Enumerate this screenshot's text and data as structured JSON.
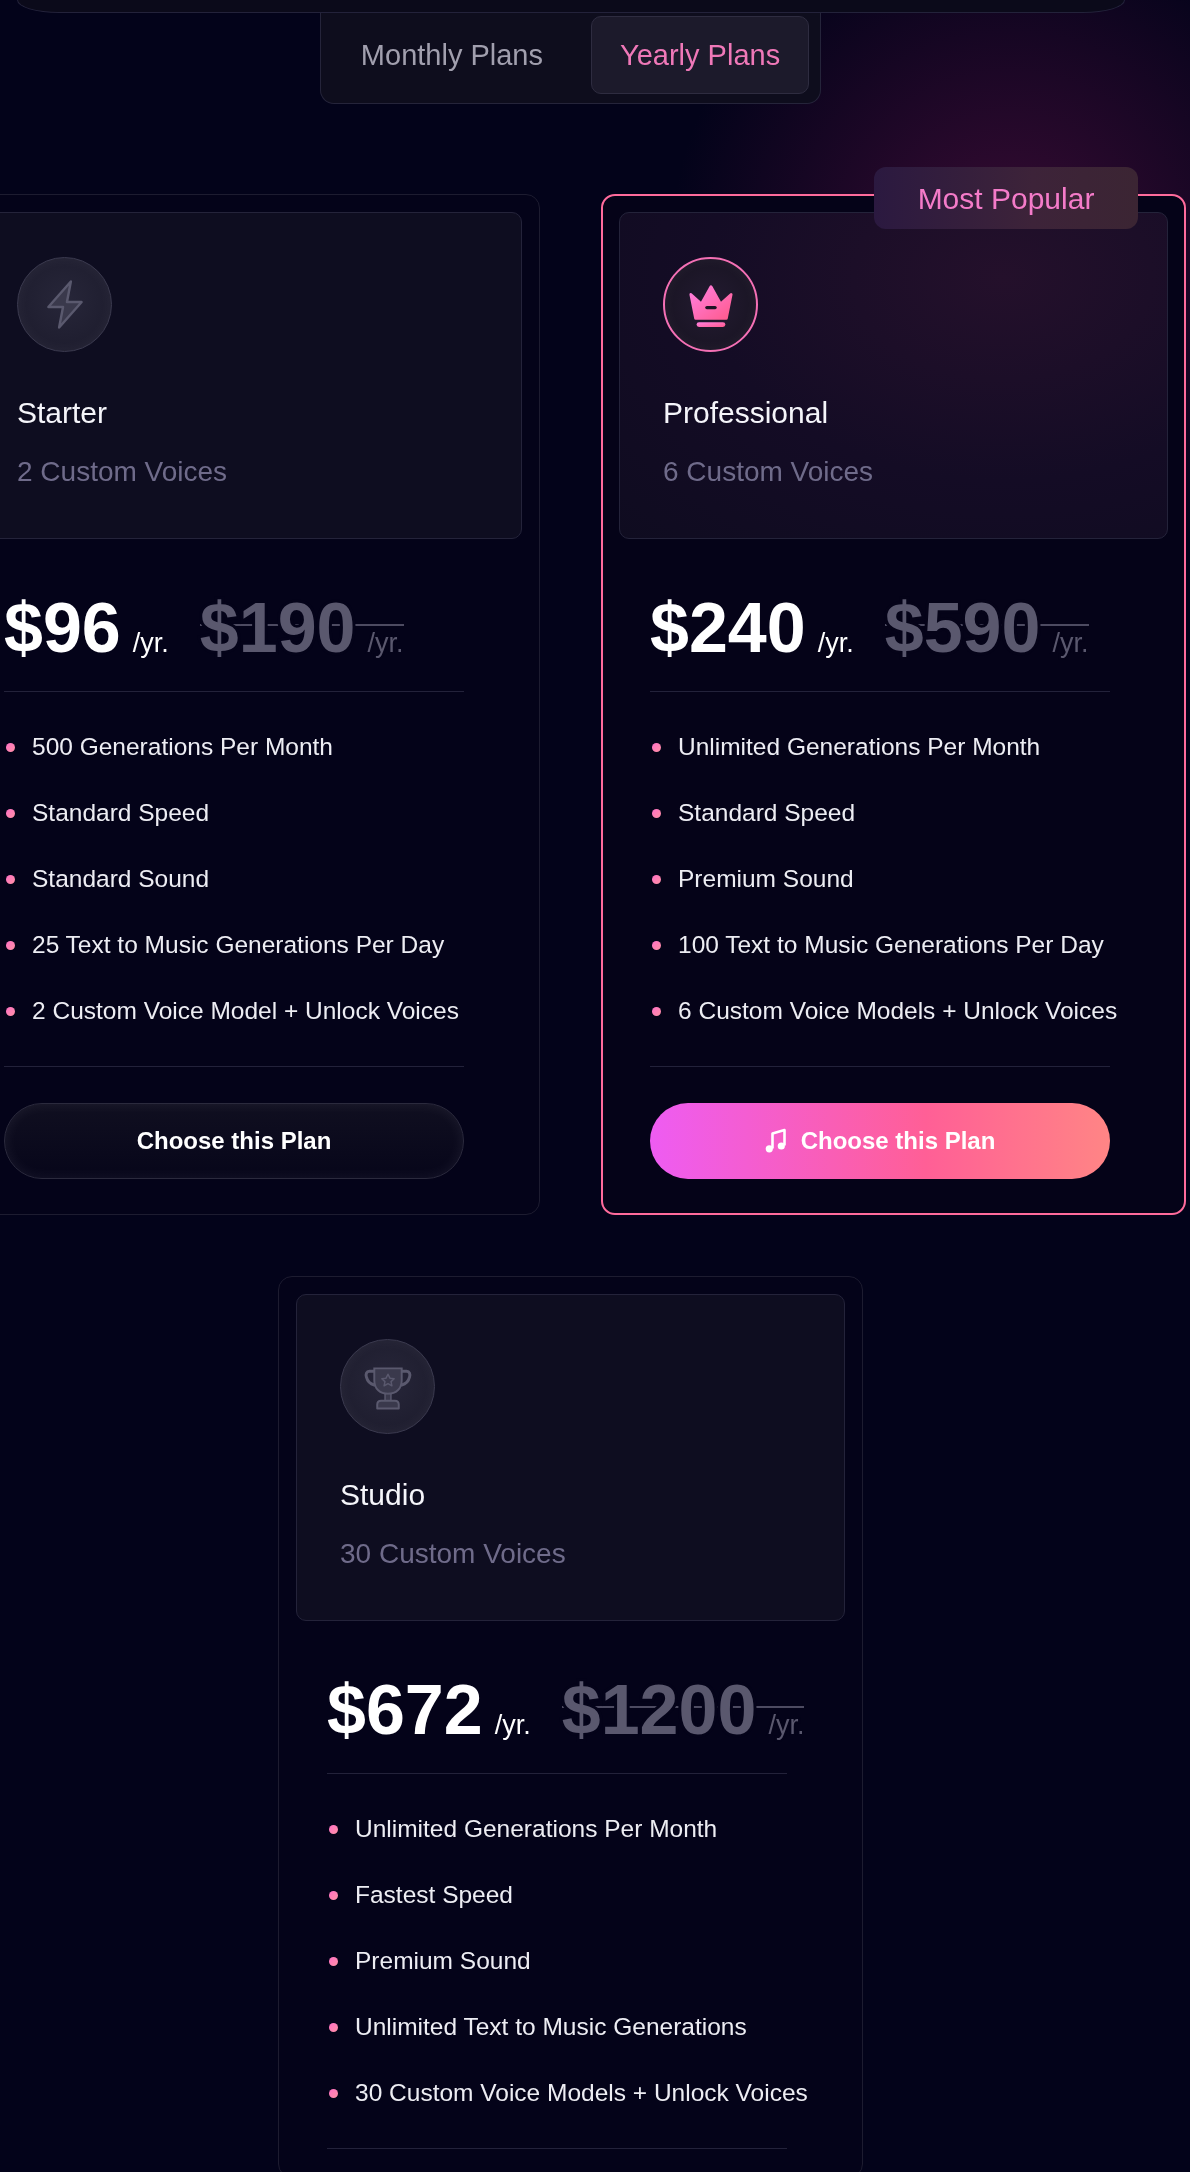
{
  "billing_tabs": [
    {
      "label": "Monthly Plans",
      "selected": false
    },
    {
      "label": "Yearly Plans",
      "selected": true
    }
  ],
  "plans": [
    {
      "name": "Starter",
      "voices": "2 Custom Voices",
      "featured": false,
      "price": "$96",
      "period": "/yr.",
      "old_price": "$190",
      "old_period": "/yr.",
      "features": [
        "500 Generations Per Month",
        "Standard Speed",
        "Standard Sound",
        "25 Text to Music Generations Per Day",
        "2 Custom Voice Model + Unlock Voices"
      ],
      "button": "Choose this Plan"
    },
    {
      "name": "Professional",
      "voices": "6 Custom Voices",
      "featured": true,
      "badge": "Most Popular",
      "price": "$240",
      "period": "/yr.",
      "old_price": "$590",
      "old_period": "/yr.",
      "features": [
        "Unlimited Generations Per Month",
        "Standard Speed",
        "Premium Sound",
        "100 Text to Music Generations Per Day",
        "6 Custom Voice Models + Unlock Voices"
      ],
      "button": "Choose this Plan"
    },
    {
      "name": "Studio",
      "voices": "30 Custom Voices",
      "featured": false,
      "price": "$672",
      "period": "/yr.",
      "old_price": "$1200",
      "old_period": "/yr.",
      "features": [
        "Unlimited Generations Per Month",
        "Fastest Speed",
        "Premium Sound",
        "Unlimited Text to Music Generations",
        "30 Custom Voice Models + Unlock Voices"
      ]
    }
  ]
}
